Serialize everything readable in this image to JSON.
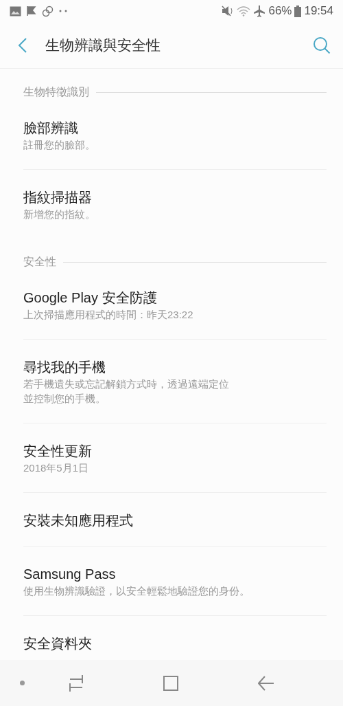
{
  "status_bar": {
    "battery": "66%",
    "time": "19:54"
  },
  "app_bar": {
    "title": "生物辨識與安全性"
  },
  "sections": [
    {
      "header": "生物特徵識別",
      "items": [
        {
          "title": "臉部辨識",
          "subtitle": "註冊您的臉部。"
        },
        {
          "title": "指紋掃描器",
          "subtitle": "新增您的指紋。"
        }
      ]
    },
    {
      "header": "安全性",
      "items": [
        {
          "title": "Google Play 安全防護",
          "subtitle": "上次掃描應用程式的時間：昨天23:22"
        },
        {
          "title": "尋找我的手機",
          "subtitle": [
            "若手機遺失或忘記解鎖方式時，透過遠端定位",
            "並控制您的手機。"
          ]
        },
        {
          "title": "安全性更新",
          "subtitle": "2018年5月1日"
        },
        {
          "title": "安裝未知應用程式"
        },
        {
          "title": "Samsung Pass",
          "subtitle": "使用生物辨識驗證，以安全輕鬆地驗證您的身份。"
        },
        {
          "title": "安全資料夾"
        }
      ]
    }
  ]
}
